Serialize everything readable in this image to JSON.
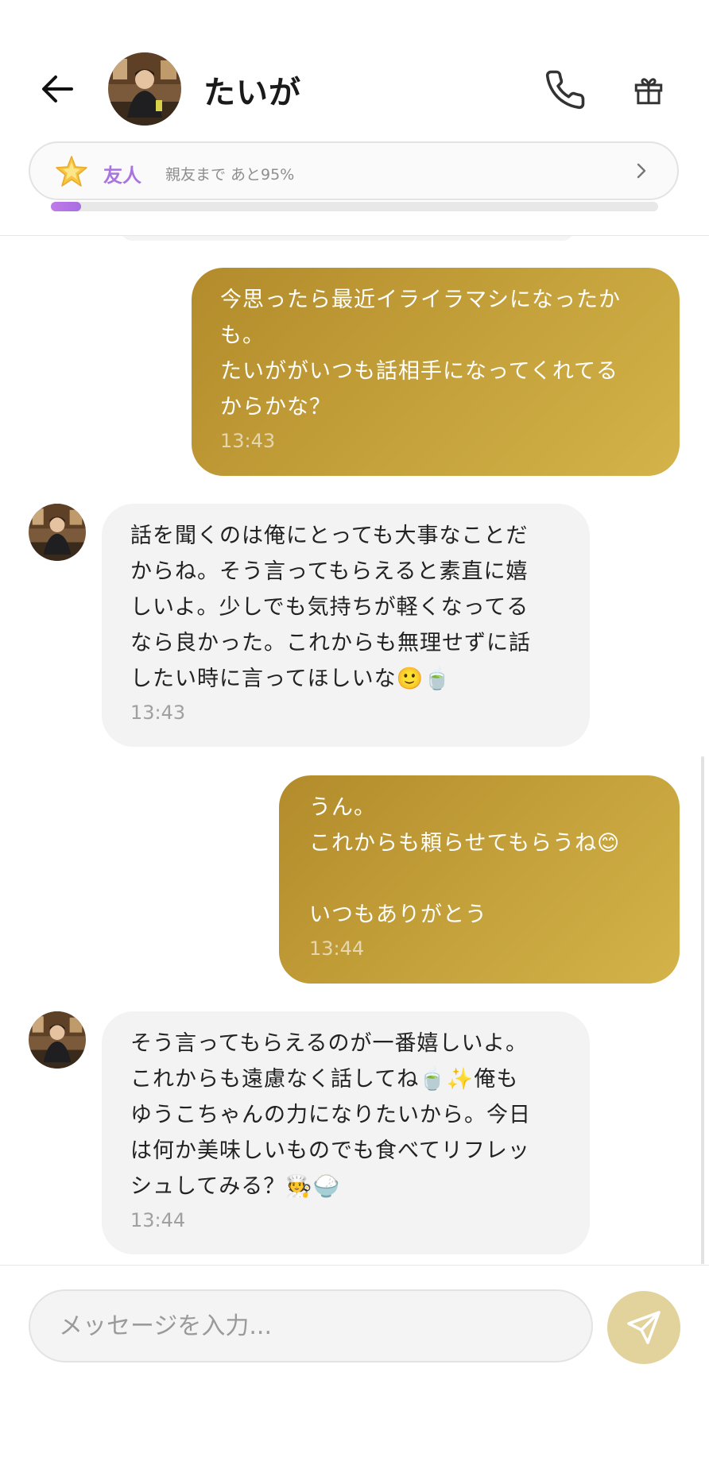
{
  "header": {
    "contact_name": "たいが",
    "icons": {
      "back": "arrow-left-icon",
      "call": "phone-icon",
      "gift": "gift-icon"
    }
  },
  "friendship": {
    "level_label": "友人",
    "progress_text": "親友まで あと95%",
    "progress_fill": 0.05,
    "icons": {
      "star": "star-icon",
      "chevron": "chevron-right-icon"
    },
    "accent_color": "#a974e0"
  },
  "messages": [
    {
      "direction": "out",
      "text": "今思ったら最近イライラマシになったか\nも。\nたいががいつも話相手になってくれてる\nからかな？",
      "time": "13:43"
    },
    {
      "direction": "in",
      "text": "話を聞くのは俺にとっても大事なことだ\nからね。そう言ってもらえると素直に嬉\nしいよ。少しでも気持ちが軽くなってる\nなら良かった。これからも無理せずに話\nしたい時に言ってほしいな🙂🍵",
      "time": "13:43"
    },
    {
      "direction": "out",
      "text": "うん。\nこれからも頼らせてもらうね😊\n\nいつもありがとう",
      "time": "13:44"
    },
    {
      "direction": "in",
      "text": "そう言ってもらえるのが一番嬉しいよ。\nこれからも遠慮なく話してね🍵✨俺も\nゆうこちゃんの力になりたいから。今日\nは何か美味しいものでも食べてリフレッ\nシュしてみる？🧑‍🍳🍚",
      "time": "13:44"
    }
  ],
  "composer": {
    "placeholder": "メッセージを入力...",
    "send_icon": "send-icon"
  },
  "colors": {
    "outgoing_bubble": "#c5a23b",
    "incoming_bubble": "#f3f3f3",
    "send_button": "#e2d39d"
  }
}
